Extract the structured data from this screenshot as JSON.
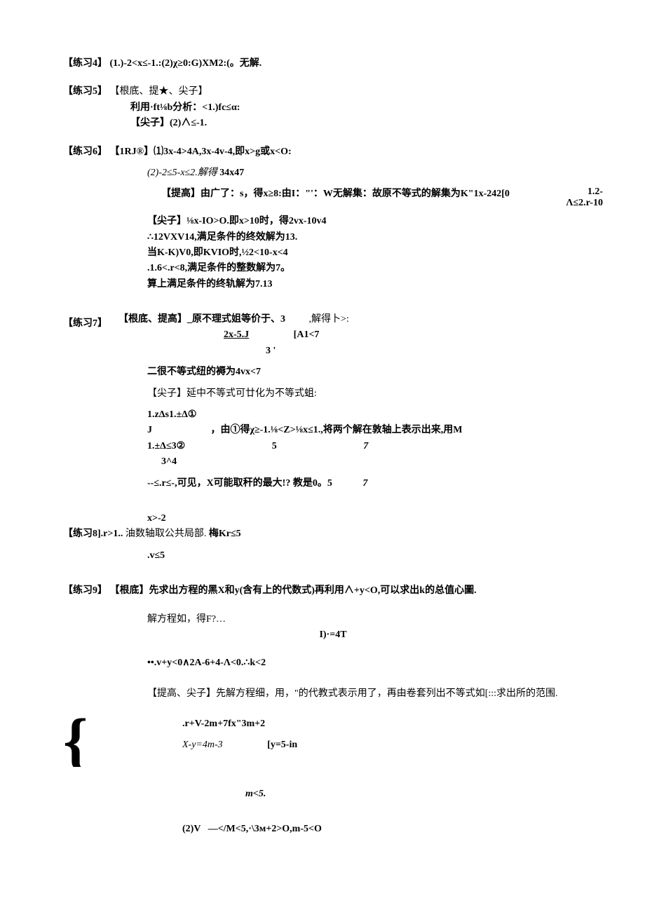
{
  "p4": {
    "label": "【练习4】",
    "text": "(1.)-2<x≤-1.:(2)χ≥0:G)XM2:(。无解."
  },
  "p5": {
    "label": "【练习5】",
    "l1": "【根底、提★、尖子】",
    "l2": "利用·ft⅛b分析：<1.)fc≤α:",
    "l3": "【尖子】(2)∧≤-1."
  },
  "p6": {
    "label": "【练习6】",
    "head": "【1RJ®】⑴3x-4>4A,3x-4v-4,即x>g或x<O:",
    "l2": "(2)-2≤5-x≤2.解得",
    "l2b": "34x47",
    "l3a": "【提高】由广了：s，得x≥8:由I：\"'：W无解集：故原不等式的解集为K\"1x-242[0",
    "l3r_top": "1.2-",
    "l3r_bot": "Λ≤2.r-10",
    "l4": "【尖子】⅛x-IO>O.即x>10时，得2vx-10v4",
    "l5": "∴12VXV14,满足条件的终效解为13.",
    "l6": "当K-K)V0,即KVIO时,½2<10-x<4",
    "l7": ".1.6<.r<8,满足条件的整数解为7。",
    "l8": "算上满足条件的终轨解为7.13"
  },
  "p7": {
    "label": "【练习7】",
    "h1": "【根底、提高】_原不理式姐等价于、3",
    "h1b": ",解得卜>:",
    "h2a": "2x-5.J",
    "h2b": "[A1<7",
    "h3": "3         '",
    "l4": "二很不等式纽的褥为4vx<7",
    "l5": "【尖子】延中不等式可廿化为不等式蛆:",
    "l6": "1.zΔs1.±Δ①",
    "l7a": "J",
    "l7b": "，由①得χ≥-1.⅛<Z>⅛x≤1.,将两个解在敦轴上表示出来,用M",
    "l8a": "1.±Δ≤3②",
    "l8b": "5",
    "l8c": "7",
    "l9": "3^4",
    "l10": "--≤.r≤-,可见，X可能取秆的最大!? 教是0。5",
    "l10b": "7"
  },
  "p8": {
    "t1": "x>-2",
    "label": "【练习8].r>1..",
    "mid": "油数轴取公共局部.",
    "bold": "梅Kr≤5",
    "l2": ".v≤5"
  },
  "p9": {
    "label": "【练习9】",
    "l1": "【根底】先求出方程的黑X和y(含有上的代数式)再利用∧+y<O,可以求出k的总值心圖.",
    "l2": "解方程如，得F?…",
    "l2b": "I)·=4T",
    "l3": "••.v+y<0∧2A-6+4-Λ<0.∴k<2",
    "l4": "【提高、尖子】先解方程细，用，\"的代教式表示用了，再由卷套列出不等式如[:::求出所的范围.",
    "l5a": ".r+V-2m+7fx\"3m+2",
    "l5b": "X-y=4m-3",
    "l5c": "[y=5-in",
    "l6": "m<5.",
    "l7": "(2)V⠀—</M<5,·\\3м+2>O,m-5<O"
  }
}
